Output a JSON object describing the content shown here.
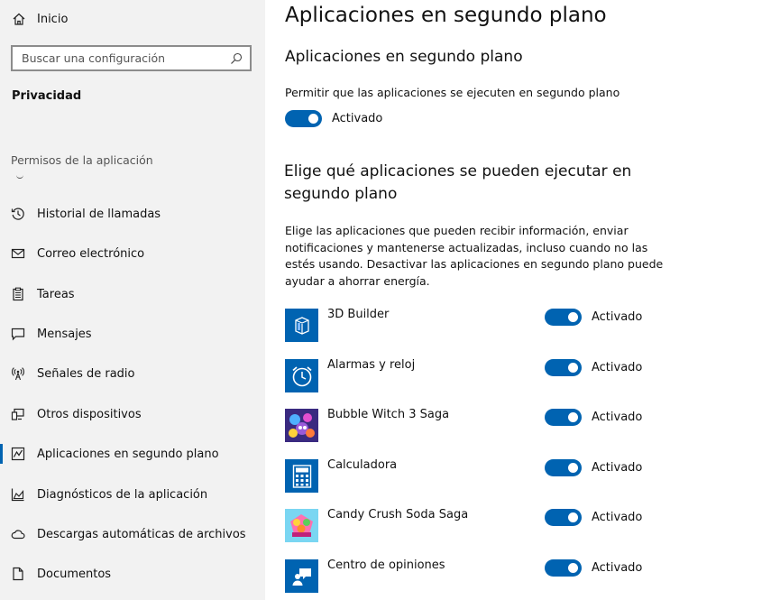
{
  "sidebar": {
    "home_label": "Inicio",
    "search_placeholder": "Buscar una configuración",
    "section_title": "Privacidad",
    "group_label": "Permisos de la aplicación",
    "items": [
      {
        "label": "Historial de llamadas",
        "icon": "history-icon"
      },
      {
        "label": "Correo electrónico",
        "icon": "mail-icon"
      },
      {
        "label": "Tareas",
        "icon": "tasks-icon"
      },
      {
        "label": "Mensajes",
        "icon": "message-icon"
      },
      {
        "label": "Señales de radio",
        "icon": "radio-icon"
      },
      {
        "label": "Otros dispositivos",
        "icon": "devices-icon"
      },
      {
        "label": "Aplicaciones en segundo plano",
        "icon": "background-apps-icon",
        "selected": true
      },
      {
        "label": "Diagnósticos de la aplicación",
        "icon": "diagnostics-icon"
      },
      {
        "label": "Descargas automáticas de archivos",
        "icon": "cloud-icon"
      },
      {
        "label": "Documentos",
        "icon": "document-icon"
      }
    ]
  },
  "main": {
    "title": "Aplicaciones en segundo plano",
    "subtitle": "Aplicaciones en segundo plano",
    "allow_text": "Permitir que las aplicaciones se ejecuten en segundo plano",
    "master_toggle": {
      "state": "on",
      "label": "Activado"
    },
    "choose_title": "Elige qué aplicaciones se pueden ejecutar en segundo plano",
    "choose_desc": "Elige las aplicaciones que pueden recibir información, enviar notificaciones y mantenerse actualizadas, incluso cuando no las estés usando. Desactivar las aplicaciones en segundo plano puede ayudar a ahorrar energía.",
    "apps": [
      {
        "name": "3D Builder",
        "icon": "3d-builder-icon",
        "toggle_label": "Activado",
        "state": "on"
      },
      {
        "name": "Alarmas y reloj",
        "icon": "alarm-clock-icon",
        "toggle_label": "Activado",
        "state": "on"
      },
      {
        "name": "Bubble Witch 3 Saga",
        "icon": "bubble-witch-icon",
        "toggle_label": "Activado",
        "state": "on"
      },
      {
        "name": "Calculadora",
        "icon": "calculator-icon",
        "toggle_label": "Activado",
        "state": "on"
      },
      {
        "name": "Candy Crush Soda Saga",
        "icon": "candy-crush-icon",
        "toggle_label": "Activado",
        "state": "on"
      },
      {
        "name": "Centro de opiniones",
        "icon": "feedback-hub-icon",
        "toggle_label": "Activado",
        "state": "on"
      }
    ]
  },
  "colors": {
    "accent": "#0063b1",
    "sidebar_bg": "#f2f2f2"
  }
}
